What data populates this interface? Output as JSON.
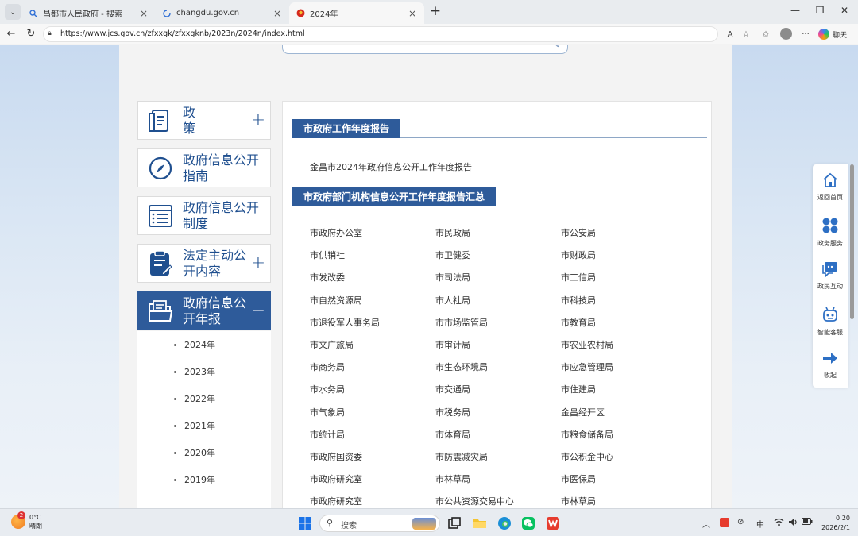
{
  "browser": {
    "tabs": [
      {
        "title": "昌都市人民政府 - 搜索",
        "favicon": "search-icon"
      },
      {
        "title": "changdu.gov.cn",
        "favicon": "loading-icon"
      },
      {
        "title": "2024年",
        "favicon": "emblem-icon"
      }
    ],
    "url": "https://www.jcs.gov.cn/zfxxgk/zfxxgknb/2023n/2024n/index.html",
    "chat_label": "聊天"
  },
  "sidebar": {
    "items": [
      {
        "label": "政 策",
        "icon": "document-icon",
        "control": "+"
      },
      {
        "label": "政府信息公开指南",
        "icon": "compass-icon",
        "control": ""
      },
      {
        "label": "政府信息公开制度",
        "icon": "list-icon",
        "control": ""
      },
      {
        "label": "法定主动公开内容",
        "icon": "clipboard-icon",
        "control": "+"
      },
      {
        "label": "政府信息公开年报",
        "icon": "folder-icon",
        "control": "−"
      }
    ],
    "years": [
      "2024年",
      "2023年",
      "2022年",
      "2021年",
      "2020年",
      "2019年"
    ]
  },
  "main": {
    "section1_title": "市政府工作年度报告",
    "report_link": "金昌市2024年政府信息公开工作年度报告",
    "section2_title": "市政府部门机构信息公开工作年度报告汇总",
    "departments": [
      "市政府办公室",
      "市民政局",
      "市公安局",
      "市供销社",
      "市卫健委",
      "市财政局",
      "市发改委",
      "市司法局",
      "市工信局",
      "市自然资源局",
      "市人社局",
      "市科技局",
      "市退役军人事务局",
      "市市场监管局",
      "市教育局",
      "市文广旅局",
      "市审计局",
      "市农业农村局",
      "市商务局",
      "市生态环境局",
      "市应急管理局",
      "市水务局",
      "市交通局",
      "市住建局",
      "市气象局",
      "市税务局",
      "金昌经开区",
      "市统计局",
      "市体育局",
      "市粮食储备局",
      "市政府国资委",
      "市防震减灾局",
      "市公积金中心",
      "市政府研究室",
      "市林草局",
      "市医保局",
      "市政府研究室",
      "市公共资源交易中心",
      "市林草局"
    ]
  },
  "float_panel": {
    "items": [
      {
        "label": "返回首页",
        "icon": "home-icon"
      },
      {
        "label": "政务服务",
        "icon": "grid-icon"
      },
      {
        "label": "政民互动",
        "icon": "chat-icon"
      },
      {
        "label": "智能客服",
        "icon": "robot-icon"
      },
      {
        "label": "收起",
        "icon": "arrow-right-icon"
      }
    ]
  },
  "taskbar": {
    "weather_badge": "2",
    "temperature": "0°C",
    "condition": "晴朗",
    "search_placeholder": "搜索",
    "ime": "中",
    "time": "0:20",
    "date": "2026/2/1"
  }
}
